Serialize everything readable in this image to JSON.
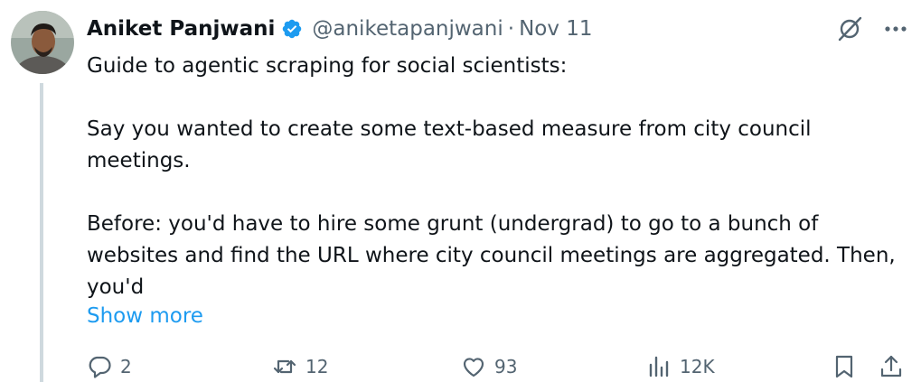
{
  "author": {
    "display_name": "Aniket Panjwani",
    "handle": "@aniketapanjwani",
    "separator": "·",
    "date": "Nov 11",
    "verified": true,
    "avatar_icon": "avatar",
    "verified_color": "#1d9bf0"
  },
  "header_actions": {
    "grok_icon": "grok-icon",
    "more_icon": "more-icon"
  },
  "body": {
    "line1": "Guide to agentic scraping for social scientists:",
    "para2": "Say you wanted to create some text-based measure from city council meetings.",
    "para3": "Before: you'd have to hire some grunt (undergrad) to go to a bunch of websites and find the URL where city council meetings are aggregated. Then, you'd"
  },
  "show_more_label": "Show more",
  "actions": {
    "reply_count": "2",
    "retweet_count": "12",
    "like_count": "93",
    "views_count": "12K"
  },
  "colors": {
    "text": "#0f1419",
    "secondary": "#536471",
    "accent": "#1d9bf0",
    "thread_line": "#cfd9de"
  }
}
